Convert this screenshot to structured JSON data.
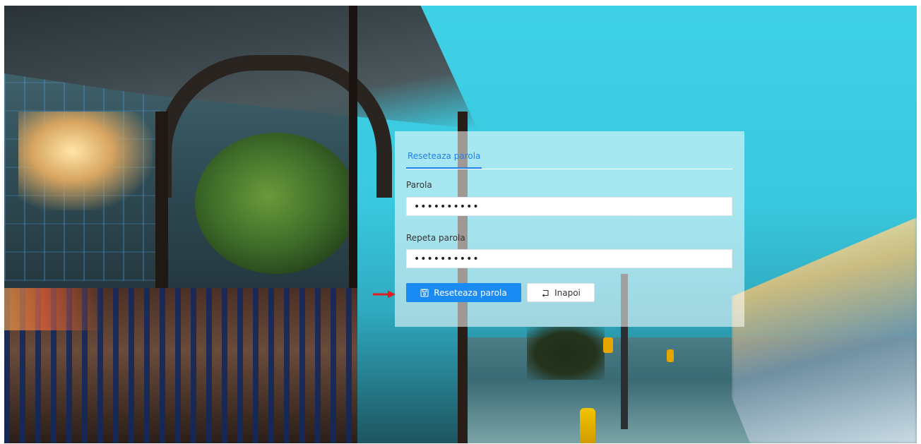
{
  "form": {
    "tab_label": "Reseteaza parola",
    "password_label": "Parola",
    "password_value": "••••••••••",
    "repeat_label": "Repeta parola",
    "repeat_value": "••••••••••",
    "submit_label": "Reseteaza parola",
    "back_label": "Inapoi"
  },
  "icons": {
    "submit": "save-icon",
    "back": "return-icon",
    "annotation": "red-arrow-icon"
  },
  "colors": {
    "accent": "#1a8bf2",
    "annotation": "#e02020"
  }
}
